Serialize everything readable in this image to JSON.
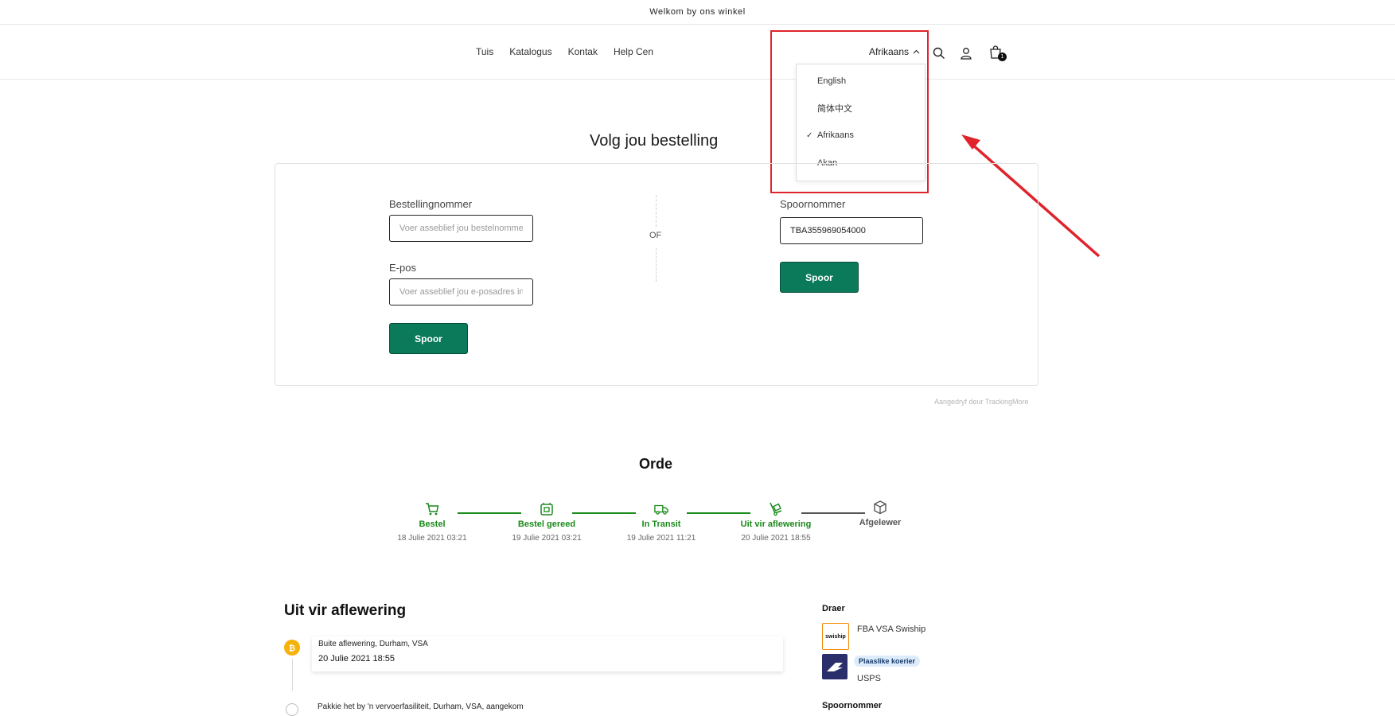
{
  "announcement": "Welkom by ons winkel",
  "nav": {
    "items": [
      "Tuis",
      "Katalogus",
      "Kontak",
      "Help Cen"
    ]
  },
  "header": {
    "language_current": "Afrikaans",
    "cart_count": "1"
  },
  "language_menu": {
    "options": [
      "English",
      "简体中文",
      "Afrikaans",
      "Akan"
    ],
    "selected": "Afrikaans",
    "check_mark": "✓"
  },
  "tracking": {
    "title": "Volg jou bestelling",
    "order_label": "Bestellingnommer",
    "order_placeholder": "Voer asseblief jou bestelnommer in",
    "email_label": "E-pos",
    "email_placeholder": "Voer asseblief jou e-posadres in",
    "track_button": "Spoor",
    "or_label": "OF",
    "tracking_label": "Spoornommer",
    "tracking_value": "TBA355969054000",
    "powered_by": "Aangedryf deur TrackingMore"
  },
  "order": {
    "title": "Orde",
    "steps": [
      {
        "label": "Bestel",
        "date": "18 Julie 2021 03:21",
        "icon": "cart-icon",
        "done": true
      },
      {
        "label": "Bestel gereed",
        "date": "19 Julie 2021 03:21",
        "icon": "package-ready-icon",
        "done": true
      },
      {
        "label": "In Transit",
        "date": "19 Julie 2021 11:21",
        "icon": "truck-icon",
        "done": true
      },
      {
        "label": "Uit vir aflewering",
        "date": "20 Julie 2021 18:55",
        "icon": "hand-truck-icon",
        "done": true
      },
      {
        "label": "Afgelewer",
        "date": "",
        "icon": "box-icon",
        "done": false
      }
    ],
    "active_color": "#1a8a1a",
    "inactive_color": "#555555"
  },
  "delivery": {
    "title": "Uit vir aflewering",
    "events": [
      {
        "location": "Buite aflewering, Durham, VSA",
        "time": "20 Julie 2021 18:55"
      },
      {
        "location": "Pakkie het by 'n vervoerfasiliteit, Durham, VSA, aangekom",
        "time": ""
      }
    ]
  },
  "sidebar": {
    "carrier_heading": "Draer",
    "carrier_name": "FBA VSA Swiship",
    "carrier_logo_text": "swiship",
    "local_badge": "Plaaslike koerier",
    "local_carrier": "USPS",
    "tracking_heading": "Spoornommer"
  },
  "colors": {
    "brand_green": "#0a7a5a",
    "annotation_red": "#e0232b"
  }
}
